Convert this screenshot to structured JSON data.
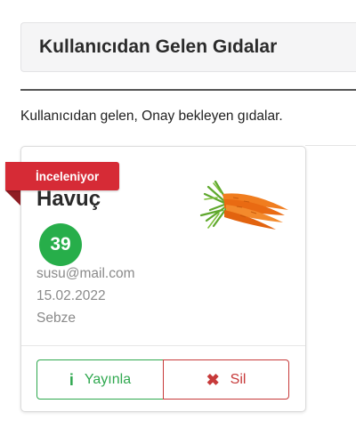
{
  "header": {
    "title": "Kullanıcıdan Gelen Gıdalar"
  },
  "description": "Kullanıcıdan gelen, Onay bekleyen gıdalar.",
  "card": {
    "status_badge": "İnceleniyor",
    "food_name": "Havuç",
    "score": "39",
    "email": "susu@mail.com",
    "date": "15.02.2022",
    "category": "Sebze",
    "image_icon": "carrot-image",
    "publish_label": "Yayınla",
    "publish_icon": "info-icon",
    "delete_label": "Sil",
    "delete_icon": "close-icon"
  },
  "colors": {
    "badge_red": "#d62b36",
    "score_green": "#27ae4a",
    "publish_green": "#2fa84f",
    "delete_red": "#c73a3a"
  }
}
